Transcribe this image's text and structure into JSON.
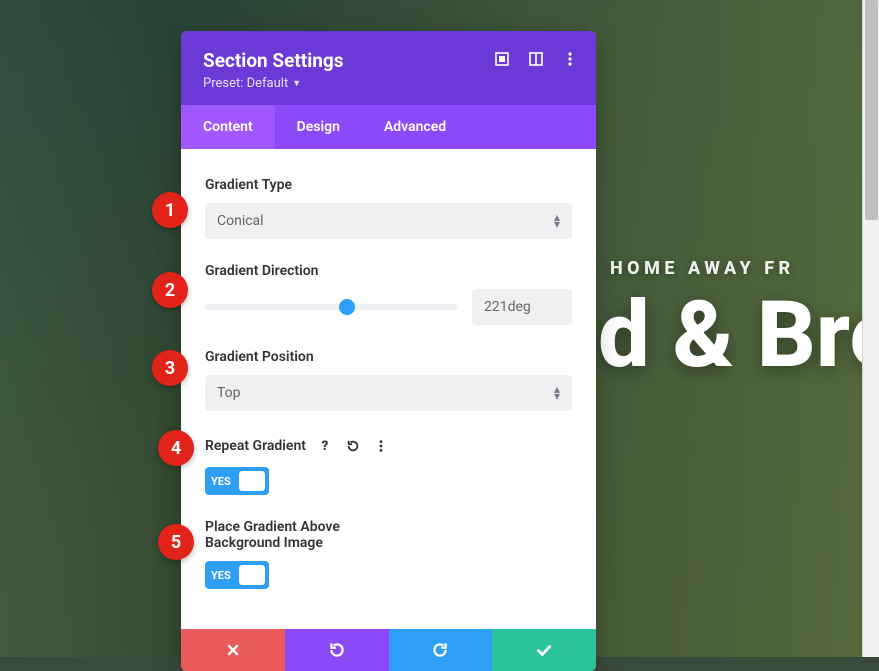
{
  "background": {
    "overline": "HOME AWAY FR",
    "headline": "d & Bre"
  },
  "modal": {
    "title": "Section Settings",
    "preset": "Preset: Default",
    "tabs": {
      "content": "Content",
      "design": "Design",
      "advanced": "Advanced"
    }
  },
  "fields": {
    "gradientType": {
      "label": "Gradient Type",
      "value": "Conical"
    },
    "gradientDirection": {
      "label": "Gradient Direction",
      "value": "221deg",
      "percent": 56
    },
    "gradientPosition": {
      "label": "Gradient Position",
      "value": "Top"
    },
    "repeatGradient": {
      "label": "Repeat Gradient",
      "value": "YES"
    },
    "placeAbove": {
      "label": "Place Gradient Above Background Image",
      "value": "YES"
    }
  },
  "steps": {
    "s1": "1",
    "s2": "2",
    "s3": "3",
    "s4": "4",
    "s5": "5"
  }
}
